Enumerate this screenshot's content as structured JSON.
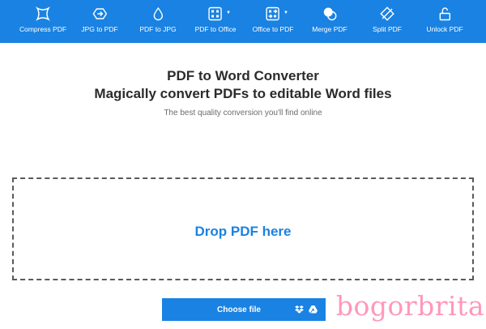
{
  "toolbar": {
    "items": [
      {
        "label": "Compress PDF",
        "icon": "compress-icon"
      },
      {
        "label": "JPG to PDF",
        "icon": "jpg-to-pdf-icon"
      },
      {
        "label": "PDF to JPG",
        "icon": "pdf-to-jpg-icon"
      },
      {
        "label": "PDF to Office",
        "icon": "pdf-to-office-icon",
        "has_dropdown": true
      },
      {
        "label": "Office to PDF",
        "icon": "office-to-pdf-icon",
        "has_dropdown": true
      },
      {
        "label": "Merge PDF",
        "icon": "merge-icon"
      },
      {
        "label": "Split PDF",
        "icon": "split-icon"
      },
      {
        "label": "Unlock PDF",
        "icon": "unlock-icon"
      }
    ]
  },
  "main": {
    "title": "PDF to Word Converter",
    "subtitle": "Magically convert PDFs to editable Word files",
    "tagline": "The best quality conversion you'll find online",
    "drop_zone_text": "Drop PDF here",
    "choose_file_label": "Choose file",
    "cloud_icons": [
      "dropbox-icon",
      "google-drive-icon"
    ]
  },
  "watermark": "bogorbrita",
  "colors": {
    "accent": "#1a82e2",
    "text": "#2b2b2b",
    "muted": "#6b6b6b",
    "drop_border": "#5a5a5a",
    "watermark": "#ff7fa8"
  }
}
